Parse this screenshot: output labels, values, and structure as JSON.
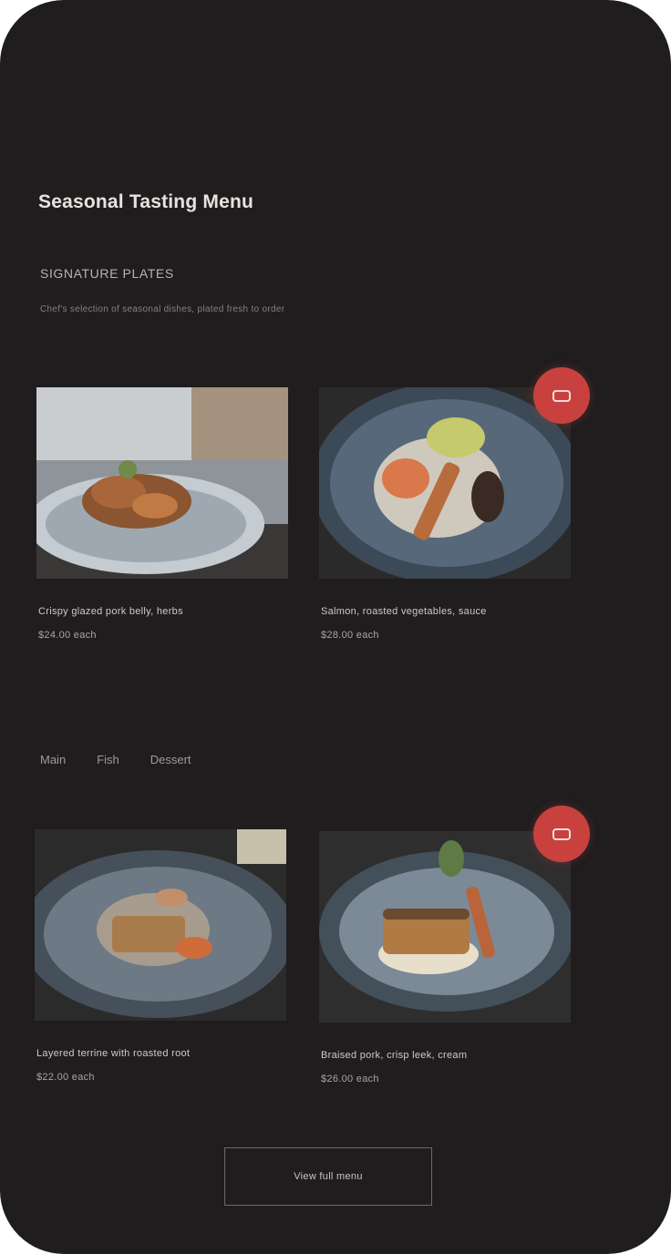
{
  "menu": {
    "title": "Seasonal Tasting Menu",
    "section_heading": "SIGNATURE PLATES",
    "section_subtitle": "Chef's selection of seasonal dishes, plated fresh to order"
  },
  "cards": [
    {
      "title": "Crispy glazed pork belly, herbs",
      "price": "$24.00 each"
    },
    {
      "title": "Salmon, roasted vegetables, sauce",
      "price": "$28.00 each"
    },
    {
      "title": "Layered terrine with roasted root",
      "price": "$22.00 each"
    },
    {
      "title": "Braised pork, crisp leek, cream",
      "price": "$26.00 each"
    }
  ],
  "filters": [
    "Main",
    "Fish",
    "Dessert"
  ],
  "cta_label": "View full menu",
  "colors": {
    "background": "#1f1d1e",
    "accent": "#c8413f"
  },
  "icons": {
    "favorite_badge": "bookmark-icon"
  }
}
